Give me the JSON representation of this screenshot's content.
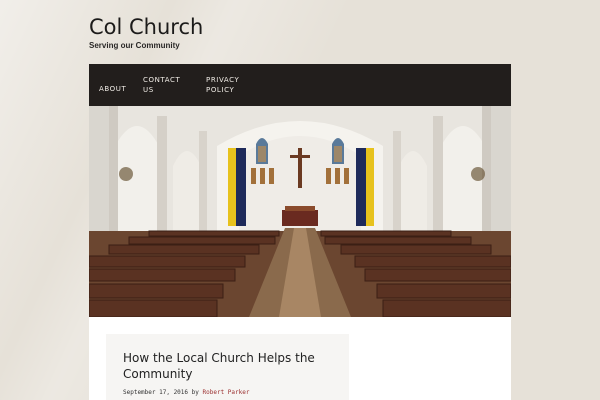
{
  "site": {
    "title": "Col Church",
    "tagline": "Serving our Community"
  },
  "nav": {
    "items": [
      {
        "label": "ABOUT"
      },
      {
        "label": "CONTACT\nUS"
      },
      {
        "label": "PRIVACY\nPOLICY"
      }
    ]
  },
  "hero": {
    "image_subject": "church interior with wooden pews and altar"
  },
  "post": {
    "title": "How the Local Church Helps the Community",
    "date": "September 17, 2016",
    "by": "by",
    "author": "Robert Parker"
  },
  "colors": {
    "background": "#e6e1d8",
    "nav_background": "#221e1c",
    "nav_text": "#f0ece6",
    "author_link": "#9b2f2f"
  }
}
